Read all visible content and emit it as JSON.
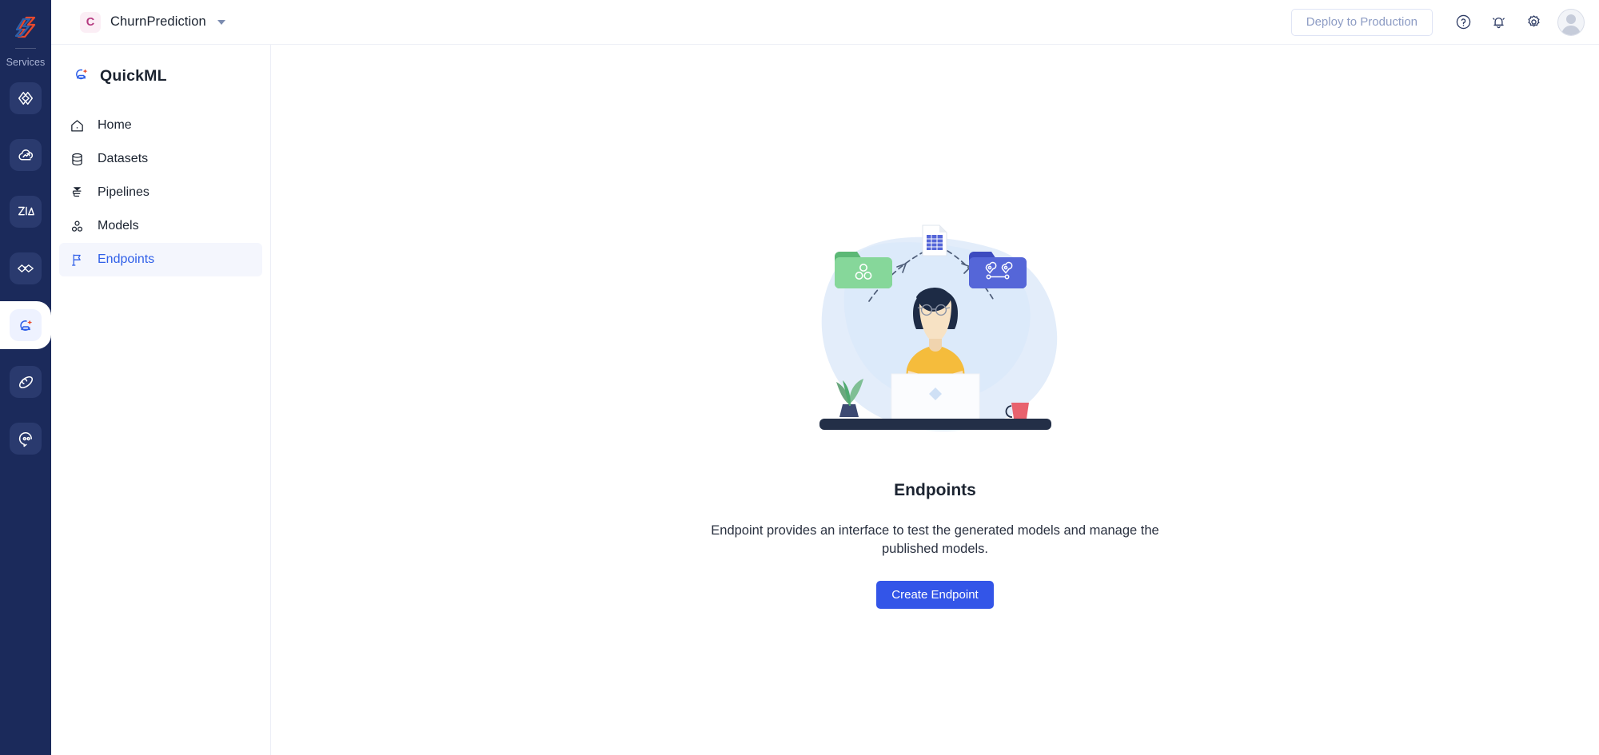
{
  "rail": {
    "logo_icon": "zoho-logo-icon",
    "services_label": "Services",
    "items": [
      {
        "name": "code-service",
        "icon": "code-brackets-icon"
      },
      {
        "name": "cloud-service",
        "icon": "cloud-analytics-icon"
      },
      {
        "name": "analytics-service",
        "icon": "zia-analytics-icon"
      },
      {
        "name": "dataprep-service",
        "icon": "dataprep-link-icon"
      },
      {
        "name": "quickml-service",
        "icon": "quickml-icon",
        "active": true
      },
      {
        "name": "flow-service",
        "icon": "flow-orbit-icon"
      },
      {
        "name": "chat-service",
        "icon": "chat-bubble-icon"
      }
    ]
  },
  "topbar": {
    "org_initial": "C",
    "org_name": "ChurnPrediction",
    "org_caret_icon": "chevron-down-icon",
    "deploy_label": "Deploy to Production",
    "help_icon": "help-circle-icon",
    "notifications_icon": "bell-icon",
    "settings_icon": "gear-icon",
    "avatar_icon": "user-avatar"
  },
  "sidebar": {
    "brand_name": "QuickML",
    "brand_icon": "quickml-logo-icon",
    "items": [
      {
        "label": "Home",
        "icon": "home-icon",
        "active": false
      },
      {
        "label": "Datasets",
        "icon": "database-icon",
        "active": false
      },
      {
        "label": "Pipelines",
        "icon": "pipeline-funnel-icon",
        "active": false
      },
      {
        "label": "Models",
        "icon": "models-nodes-icon",
        "active": false
      },
      {
        "label": "Endpoints",
        "icon": "flag-icon",
        "active": true
      }
    ]
  },
  "main": {
    "illustration": "person-at-desk-with-data-folders",
    "title": "Endpoints",
    "description": "Endpoint provides an interface to test the generated models and manage the published models.",
    "create_button_label": "Create Endpoint"
  },
  "colors": {
    "rail_background": "#1b2a5b",
    "accent_blue": "#3355e8",
    "nav_active_text": "#2f5fe8",
    "nav_active_background": "#f4f6fd",
    "org_avatar_background": "#fbeef5",
    "org_avatar_text": "#b5397f",
    "deploy_button_text": "#8d9cc4",
    "illustration_blob": "#e3edfa",
    "illustration_folder_green": "#7fd392",
    "illustration_folder_blue": "#5566d8",
    "illustration_shirt": "#f5bc3c"
  }
}
